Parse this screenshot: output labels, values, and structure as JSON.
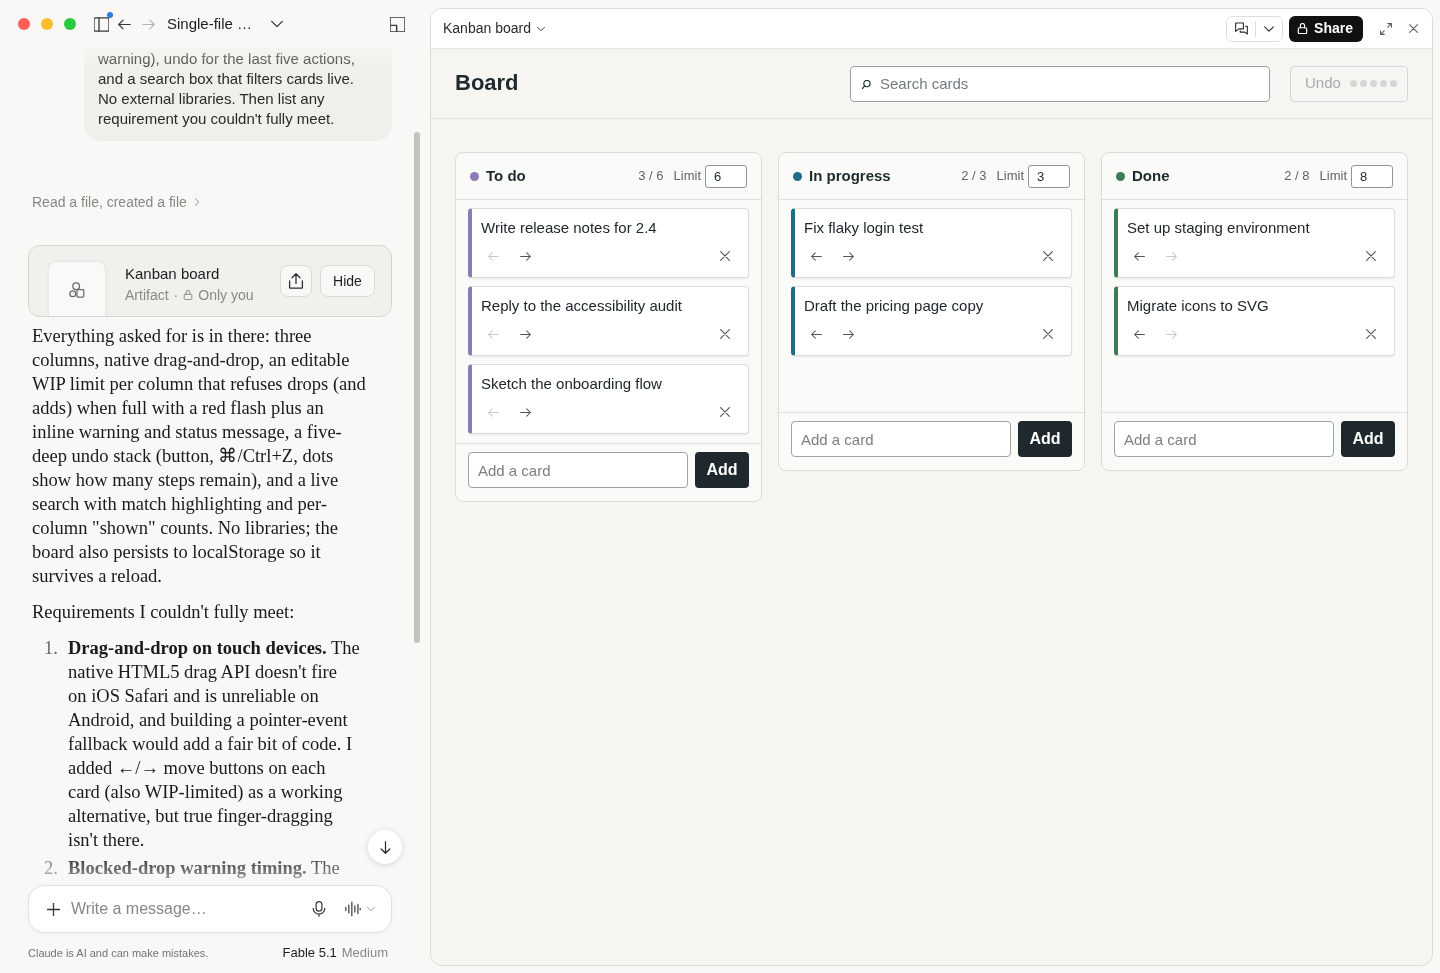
{
  "window": {
    "title": "Single-file …",
    "sidebar_unread": true,
    "back_disabled": false,
    "forward_disabled": true
  },
  "chat": {
    "user_message": "warning), undo for the last five actions, and a search box that filters cards live. No external libraries. Then list any requirement you couldn't fully meet.",
    "tool_summary": "Read a file, created a file",
    "artifact": {
      "title": "Kanban board",
      "type": "Artifact",
      "separator": "·",
      "visibility": "Only you",
      "hide_label": "Hide"
    },
    "response": {
      "paragraphs": [
        "Everything asked for is in there: three columns, native drag-and-drop, an editable WIP limit per column that refuses drops (and adds) when full with a red flash plus an inline warning and status message, a five-deep undo stack (button, ⌘/Ctrl+Z, dots show how many steps remain), and a live search with match highlighting and per-column \"shown\" counts. No libraries; the board also persists to localStorage so it survives a reload.",
        "Requirements I couldn't fully meet:"
      ],
      "list": [
        {
          "number": "1.",
          "text": "**Drag-and-drop on touch devices.** The native HTML5 drag API doesn't fire on iOS Safari and is unreliable on Android, and building a pointer-event fallback would add a fair bit of code. I added ←/→ move buttons on each card (also WIP-limited) as a working alternative, but true finger-dragging isn't there."
        },
        {
          "number": "2.",
          "text": "**Blocked-drop warning timing.** The"
        }
      ]
    },
    "composer": {
      "placeholder": "Write a message…"
    },
    "disclaimer": "Claude is AI and can make mistakes.",
    "model": {
      "name": "Fable 5.1",
      "effort": "Medium"
    }
  },
  "artifact_panel": {
    "title": "Kanban board",
    "share_label": "Share",
    "board": {
      "title": "Board",
      "search": {
        "placeholder": "Search cards"
      },
      "undo": {
        "label": "Undo",
        "disabled": true,
        "steps": [
          {
            "filled": false
          },
          {
            "filled": false
          },
          {
            "filled": false
          },
          {
            "filled": false
          },
          {
            "filled": false
          }
        ]
      },
      "columns": [
        {
          "name": "To do",
          "color": "#8e7bb5",
          "count": "3 / 6",
          "limit_label": "Limit",
          "limit": "6",
          "cards": [
            {
              "title": "Write release notes for 2.4",
              "left_disabled": true,
              "right_disabled": false
            },
            {
              "title": "Reply to the accessibility audit",
              "left_disabled": true,
              "right_disabled": false
            },
            {
              "title": "Sketch the onboarding flow",
              "left_disabled": true,
              "right_disabled": false
            }
          ],
          "add_placeholder": "Add a card",
          "add_label": "Add"
        },
        {
          "name": "In progress",
          "color": "#1f6b8a",
          "count": "2 / 3",
          "limit_label": "Limit",
          "limit": "3",
          "cards": [
            {
              "title": "Fix flaky login test",
              "left_disabled": false,
              "right_disabled": false
            },
            {
              "title": "Draft the pricing page copy",
              "left_disabled": false,
              "right_disabled": false
            }
          ],
          "add_placeholder": "Add a card",
          "add_label": "Add"
        },
        {
          "name": "Done",
          "color": "#3a7d52",
          "count": "2 / 8",
          "limit_label": "Limit",
          "limit": "8",
          "cards": [
            {
              "title": "Set up staging environment",
              "left_disabled": false,
              "right_disabled": true
            },
            {
              "title": "Migrate icons to SVG",
              "left_disabled": false,
              "right_disabled": true
            }
          ],
          "add_placeholder": "Add a card",
          "add_label": "Add"
        }
      ]
    }
  }
}
